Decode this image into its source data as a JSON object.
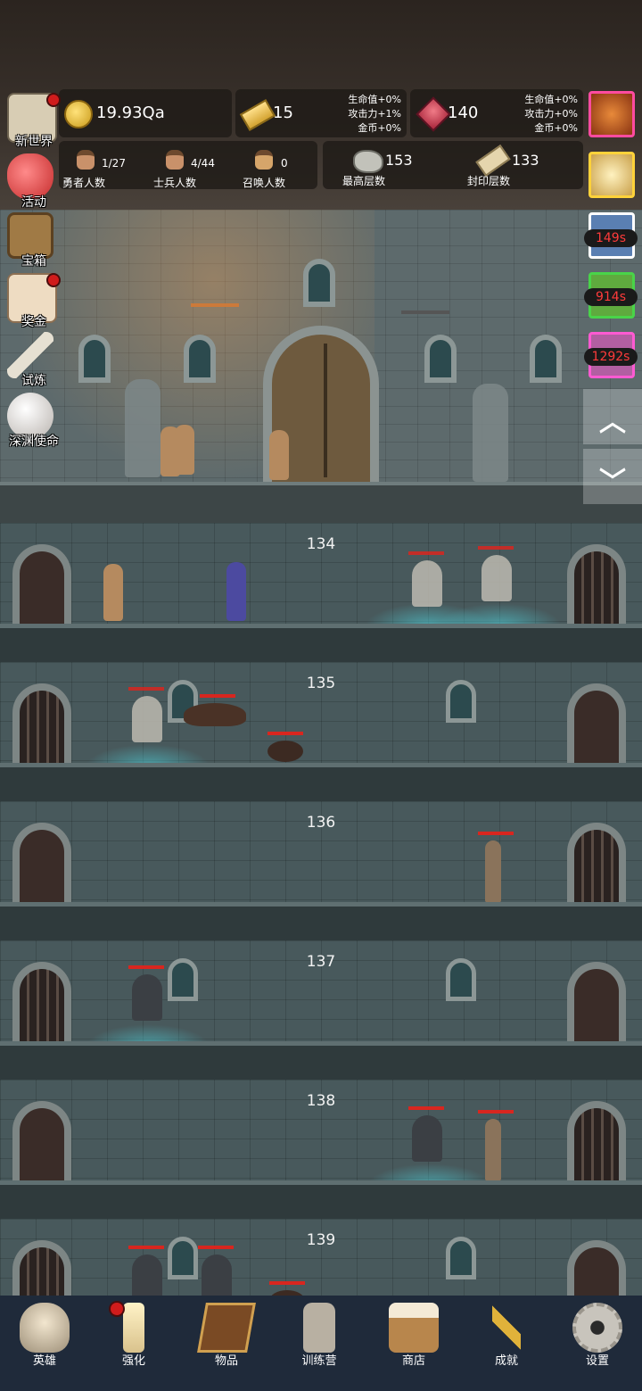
{
  "resources": {
    "gold": "19.93Qa",
    "gold_bars": "15",
    "gold_bar_bonus": [
      "生命值+0%",
      "攻击力+1%",
      "金币+0%"
    ],
    "gems": "140",
    "gem_bonus": [
      "生命值+0%",
      "攻击力+0%",
      "金币+0%"
    ]
  },
  "counts": {
    "heroes": {
      "value": "1/27",
      "label": "勇者人数"
    },
    "soldiers": {
      "value": "4/44",
      "label": "士兵人数"
    },
    "summons": {
      "value": "0",
      "label": "召唤人数"
    },
    "highest_floor": {
      "value": "153",
      "label": "最高层数"
    },
    "sealed_floor": {
      "value": "133",
      "label": "封印层数"
    }
  },
  "left_menu": [
    {
      "label": "新世界",
      "icon": "map-icon",
      "badge": true
    },
    {
      "label": "活动",
      "icon": "heart-icon",
      "badge": false
    },
    {
      "label": "宝箱",
      "icon": "chest-icon",
      "badge": false
    },
    {
      "label": "奖金",
      "icon": "envelope-icon",
      "badge": true
    },
    {
      "label": "试炼",
      "icon": "feather-icon",
      "badge": false
    },
    {
      "label": "深渊使命",
      "icon": "orb-icon",
      "badge": false
    }
  ],
  "right_buffs": [
    {
      "icon": "onion-icon",
      "timer": ""
    },
    {
      "icon": "candle-icon",
      "timer": ""
    },
    {
      "icon": "buff-blue-icon",
      "timer": "149s"
    },
    {
      "icon": "buff-green-icon",
      "timer": "914s"
    },
    {
      "icon": "buff-pink-icon",
      "timer": "1292s"
    }
  ],
  "scroll": {
    "up": "︿",
    "down": "﹀"
  },
  "floors": [
    "134",
    "135",
    "136",
    "137",
    "138",
    "139"
  ],
  "nav": [
    {
      "label": "英雄",
      "icon": "skull-icon"
    },
    {
      "label": "强化",
      "icon": "candle-icon"
    },
    {
      "label": "物品",
      "icon": "book-icon"
    },
    {
      "label": "训练营",
      "icon": "lantern-icon"
    },
    {
      "label": "商店",
      "icon": "beer-mug-icon"
    },
    {
      "label": "成就",
      "icon": "key-icon"
    },
    {
      "label": "设置",
      "icon": "gear-icon"
    }
  ],
  "colors": {
    "hp_bar": "#d8261f",
    "timer_text": "#ff3b3b",
    "nav_bg": "#1f2a3a"
  }
}
